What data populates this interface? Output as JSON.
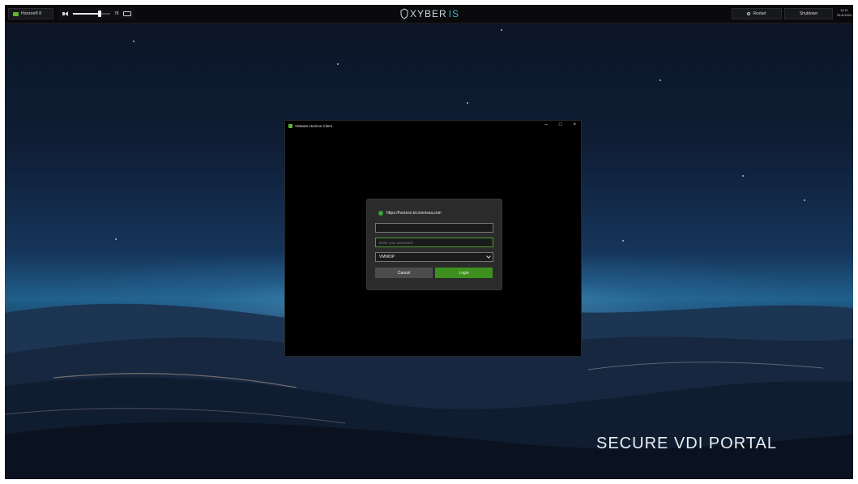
{
  "taskbar": {
    "app_label": "Horizon® 8",
    "volume_level": "78",
    "volume_fraction": 0.72,
    "brand_prefix": "XYBER",
    "brand_accent": "IS",
    "restart_label": "Restart",
    "shutdown_label": "Shutdown",
    "clock_time": "11:11",
    "clock_date": "29-8-2024"
  },
  "background": {
    "tagline": "SECURE VDI PORTAL"
  },
  "window": {
    "title": "VMware Horizon Client",
    "minimize": "–",
    "maximize": "□",
    "close": "×"
  },
  "login": {
    "server_url": "https://horizon.td.omnissa.com",
    "username_value": "",
    "password_placeholder": "Enter your password",
    "domain_selected": "VMWDP",
    "cancel_label": "Cancel",
    "login_label": "Login"
  },
  "colors": {
    "accent_green": "#3d8f1e",
    "brand_accent": "#3bb7c6",
    "app_icon": "#5cb82e"
  }
}
